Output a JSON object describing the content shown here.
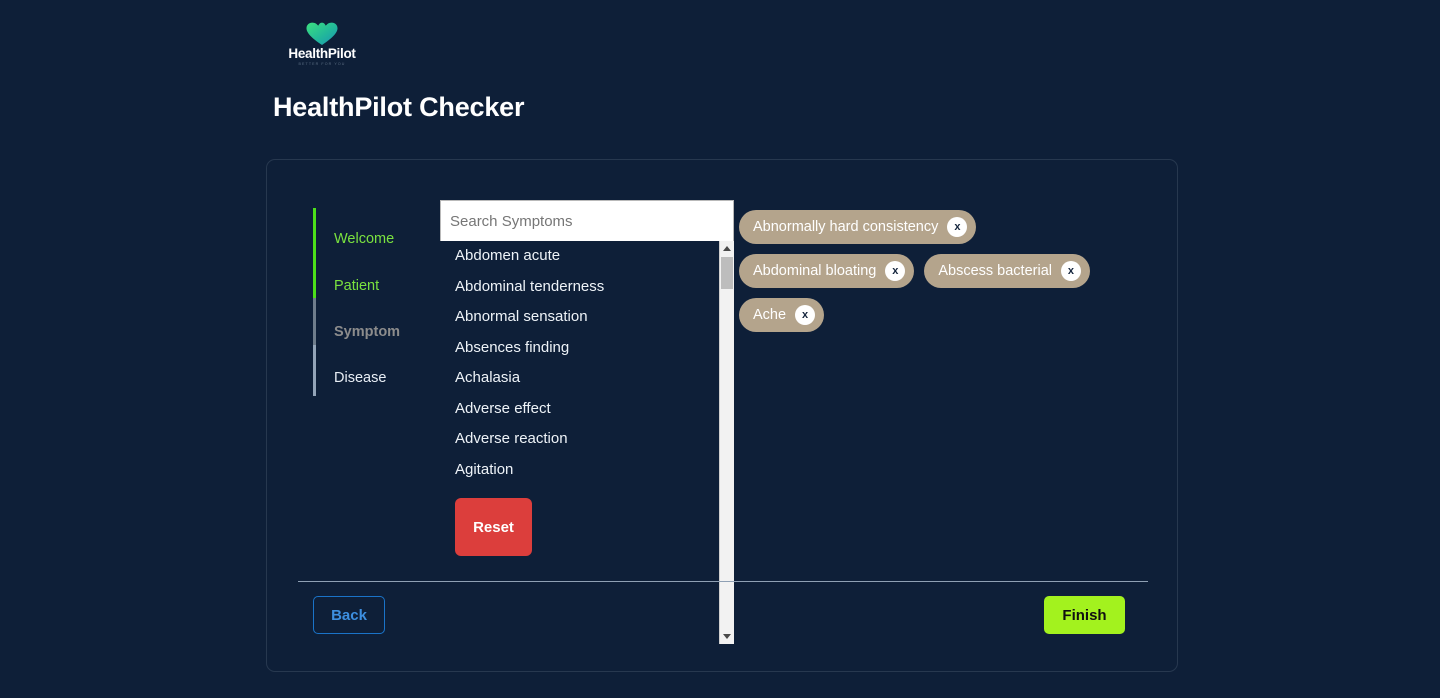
{
  "brand": {
    "name": "HealthPilot",
    "tagline": "BETTER FOR YOU",
    "logo_icon": "heart-icon",
    "logo_gradient_from": "#2fe07a",
    "logo_gradient_to": "#1aa8b8"
  },
  "page": {
    "title": "HealthPilot Checker",
    "background_color": "#0e1f38",
    "card_border_color": "#27384f"
  },
  "wizard": {
    "steps": [
      {
        "label": "Welcome",
        "state": "complete",
        "color": "#7ae23f"
      },
      {
        "label": "Patient",
        "state": "complete",
        "color": "#7ae23f"
      },
      {
        "label": "Symptom",
        "state": "current",
        "color": "#8c8c8c"
      },
      {
        "label": "Disease",
        "state": "upcoming",
        "color": "#e8eef5"
      }
    ]
  },
  "search": {
    "placeholder": "Search Symptoms",
    "value": ""
  },
  "symptom_list": {
    "items": [
      "Abdomen acute",
      "Abdominal tenderness",
      "Abnormal sensation",
      "Absences finding",
      "Achalasia",
      "Adverse effect",
      "Adverse reaction",
      "Agitation"
    ]
  },
  "selected_symptoms": {
    "remove_label": "x",
    "tag_color": "#b4a48c",
    "items": [
      {
        "label": "Abnormally hard consistency"
      },
      {
        "label": "Abdominal bloating"
      },
      {
        "label": "Abscess bacterial"
      },
      {
        "label": "Ache"
      }
    ]
  },
  "actions": {
    "reset_label": "Reset",
    "reset_color": "#dc3e3c",
    "back_label": "Back",
    "back_color": "#3d8fe0",
    "finish_label": "Finish",
    "finish_color": "#a3f21e"
  }
}
